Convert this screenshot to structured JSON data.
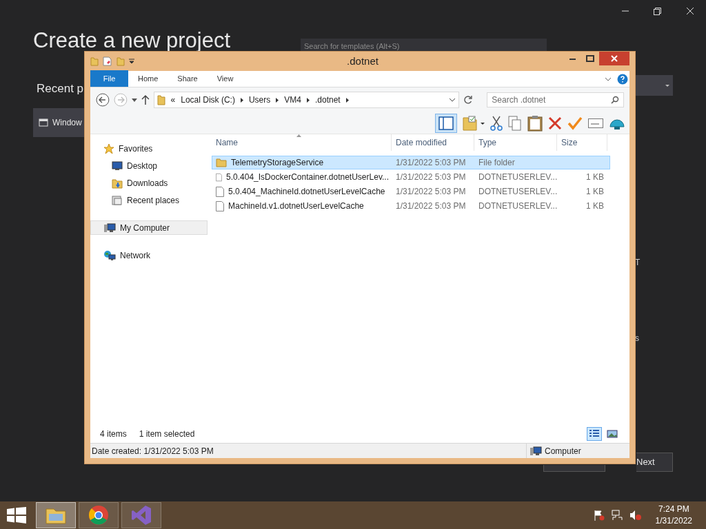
{
  "background_window": {
    "title": "Create a new project",
    "search": {
      "placeholder": "Search for templates (Alt+S)"
    },
    "recent_heading": "Recent p",
    "recent_item": "Window",
    "side_fragments": [
      "T",
      "s"
    ],
    "next_button": "Next"
  },
  "explorer": {
    "title": ".dotnet",
    "ribbon_tabs": [
      {
        "label": "File",
        "kind": "file",
        "selected": false
      },
      {
        "label": "Home",
        "kind": "tab",
        "selected": false
      },
      {
        "label": "Share",
        "kind": "tab",
        "selected": false
      },
      {
        "label": "View",
        "kind": "tab",
        "selected": false
      }
    ],
    "address": {
      "overflow": "«",
      "crumbs": [
        "Local Disk (C:)",
        "Users",
        "VM4",
        ".dotnet"
      ]
    },
    "search": {
      "placeholder": "Search .dotnet"
    },
    "navigation": [
      {
        "label": "Favorites",
        "kind": "star",
        "selected": false,
        "children": [
          {
            "label": "Desktop",
            "kind": "desktop",
            "selected": false
          },
          {
            "label": "Downloads",
            "kind": "downloads",
            "selected": false
          },
          {
            "label": "Recent places",
            "kind": "recent",
            "selected": false
          }
        ]
      },
      {
        "label": "My Computer",
        "kind": "computer",
        "selected": true
      },
      {
        "label": "Network",
        "kind": "network",
        "selected": false
      }
    ],
    "columns": [
      "Name",
      "Date modified",
      "Type",
      "Size"
    ],
    "rows": [
      {
        "kind": "folder",
        "selected": true,
        "cells": [
          "TelemetryStorageService",
          "1/31/2022 5:03 PM",
          "File folder",
          ""
        ]
      },
      {
        "kind": "file",
        "selected": false,
        "cells": [
          "5.0.404_IsDockerContainer.dotnetUserLev...",
          "1/31/2022 5:03 PM",
          "DOTNETUSERLEV...",
          "1 KB"
        ]
      },
      {
        "kind": "file",
        "selected": false,
        "cells": [
          "5.0.404_MachineId.dotnetUserLevelCache",
          "1/31/2022 5:03 PM",
          "DOTNETUSERLEV...",
          "1 KB"
        ]
      },
      {
        "kind": "file",
        "selected": false,
        "cells": [
          "MachineId.v1.dotnetUserLevelCache",
          "1/31/2022 5:03 PM",
          "DOTNETUSERLEV...",
          "1 KB"
        ]
      }
    ],
    "item_count": "4 items",
    "selection_count": "1 item selected",
    "views": [
      {
        "kind": "details",
        "selected": true
      },
      {
        "kind": "tiles",
        "selected": false
      }
    ],
    "details": "Date created: 1/31/2022 5:03 PM",
    "location": "Computer"
  },
  "taskbar": {
    "apps": [
      {
        "kind": "explorer",
        "selected": true
      },
      {
        "kind": "chrome",
        "selected": false
      },
      {
        "kind": "studio",
        "selected": false
      }
    ],
    "time": "7:24 PM",
    "date": "1/31/2022"
  }
}
